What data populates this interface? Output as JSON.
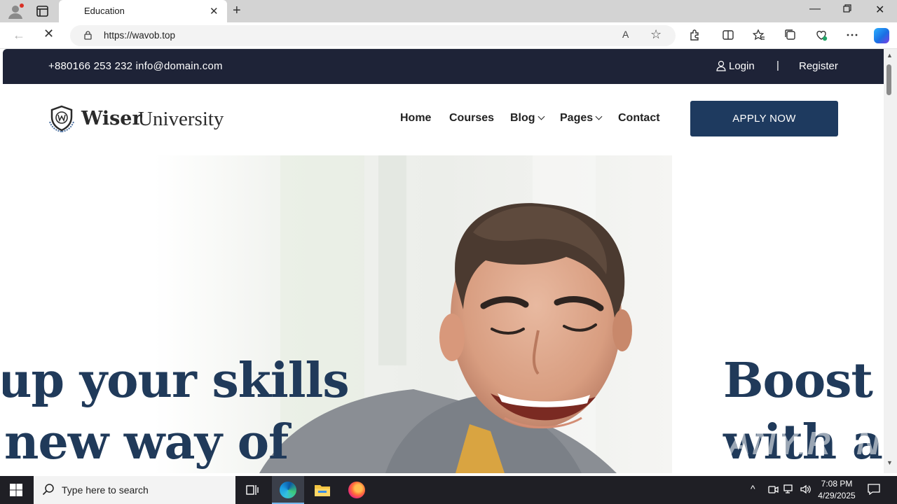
{
  "browser": {
    "tab_title": "Education",
    "url": "https://wavob.top",
    "close_glyph": "✕",
    "new_tab_glyph": "+",
    "back_glyph": "←",
    "stop_glyph": "✕",
    "read_aloud_glyph": "A",
    "favorite_glyph": "☆",
    "toolbar_icons": [
      "extensions-icon",
      "split-screen-icon",
      "favorites-icon",
      "collections-icon",
      "browser-essentials-icon",
      "more-icon"
    ],
    "window_min_glyph": "—",
    "window_close_glyph": "✕"
  },
  "site": {
    "topbar": {
      "contact": "+880166 253 232 info@domain.com",
      "login": "Login",
      "separator": "|",
      "register": "Register",
      "background": "#1e2337"
    },
    "logo": {
      "bold": "Wiser",
      "light": "University"
    },
    "nav": [
      {
        "label": "Home",
        "dropdown": false
      },
      {
        "label": "Courses",
        "dropdown": false
      },
      {
        "label": "Blog",
        "dropdown": true
      },
      {
        "label": "Pages",
        "dropdown": true
      },
      {
        "label": "Contact",
        "dropdown": false
      }
    ],
    "apply_button": "APPLY NOW",
    "accent_color": "#1e3a5f",
    "hero": {
      "left_line1": "up your skills",
      "left_line2": "new way of",
      "right_line1": "Boost u",
      "right_line2": "with a"
    },
    "watermark": "ANY.RUN"
  },
  "taskbar": {
    "search_placeholder": "Type here to search",
    "time": "7:08 PM",
    "date": "4/29/2025",
    "tray_chevron": "^"
  }
}
